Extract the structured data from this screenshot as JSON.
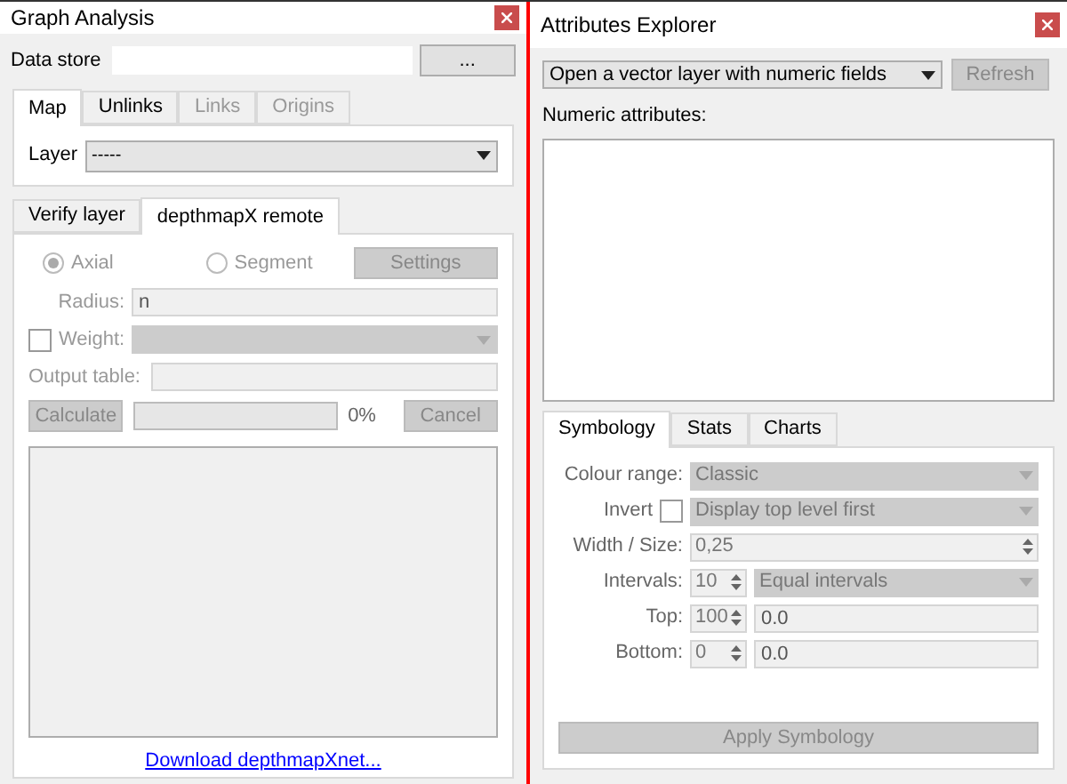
{
  "left": {
    "title": "Graph Analysis",
    "data_store": {
      "label": "Data store",
      "button": "..."
    },
    "tabs_top": [
      {
        "label": "Map",
        "selected": true,
        "disabled": false
      },
      {
        "label": "Unlinks",
        "selected": false,
        "disabled": false
      },
      {
        "label": "Links",
        "selected": false,
        "disabled": true
      },
      {
        "label": "Origins",
        "selected": false,
        "disabled": true
      }
    ],
    "layer": {
      "label": "Layer",
      "value": "-----"
    },
    "tabs_bottom": [
      {
        "label": "Verify layer",
        "selected": false
      },
      {
        "label": "depthmapX remote",
        "selected": true
      }
    ],
    "radios": [
      {
        "label": "Axial",
        "selected": true
      },
      {
        "label": "Segment",
        "selected": false
      }
    ],
    "settings_button": "Settings",
    "radius": {
      "label": "Radius:",
      "value": "n"
    },
    "weight": {
      "label": "Weight:",
      "checked": false
    },
    "output_table": {
      "label": "Output table:"
    },
    "calculate_button": "Calculate",
    "progress": {
      "level": 0,
      "reading": "0%"
    },
    "cancel_button": "Cancel",
    "link": "Download depthmapXnet..."
  },
  "right": {
    "title": "Attributes Explorer",
    "layer_combo": "Open a vector layer with numeric fields",
    "refresh_button": "Refresh",
    "numeric_label": "Numeric attributes:",
    "tabs": [
      {
        "label": "Symbology",
        "selected": true
      },
      {
        "label": "Stats",
        "selected": false
      },
      {
        "label": "Charts",
        "selected": false
      }
    ],
    "rows": [
      {
        "kind": "combo",
        "label": "Colour range:",
        "value": "Classic"
      },
      {
        "kind": "checkcombo",
        "label": "Invert",
        "checked": false,
        "value": "Display top level first"
      },
      {
        "kind": "spin",
        "label": "Width / Size:",
        "value": "0,25"
      },
      {
        "kind": "spincombo",
        "label": "Intervals:",
        "spin": "10",
        "value": "Equal intervals"
      },
      {
        "kind": "spintext",
        "label": "Top:",
        "spin": "100",
        "value": "0.0"
      },
      {
        "kind": "spintext",
        "label": "Bottom:",
        "spin": "0",
        "value": "0.0"
      }
    ],
    "apply_button": "Apply Symbology"
  }
}
